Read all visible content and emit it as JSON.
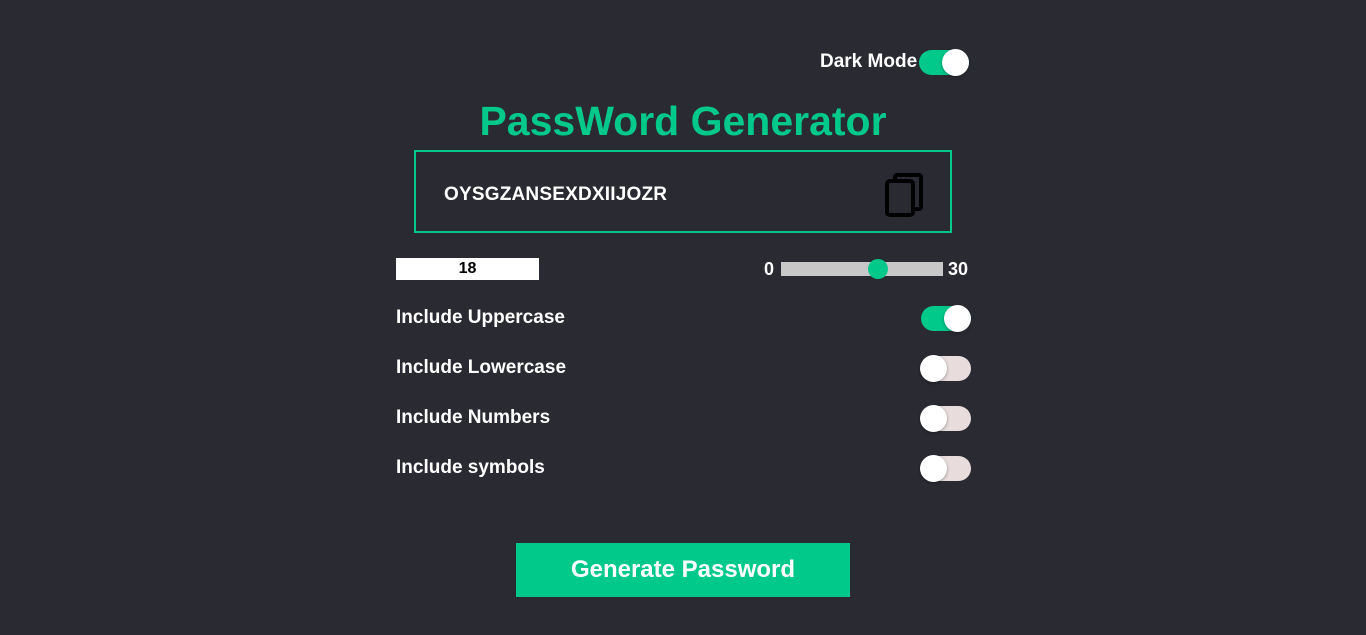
{
  "dark_mode": {
    "label": "Dark Mode",
    "enabled": true
  },
  "title": "PassWord Generator",
  "output": {
    "password": "OYSGZANSEXDXIIJOZR",
    "copy_icon": "copy-icon"
  },
  "length": {
    "value": "18",
    "min_label": "0",
    "max_label": "30",
    "min": 0,
    "max": 30,
    "current": 18
  },
  "options": [
    {
      "label": "Include Uppercase",
      "enabled": true
    },
    {
      "label": "Include Lowercase",
      "enabled": false
    },
    {
      "label": "Include Numbers",
      "enabled": false
    },
    {
      "label": "Include symbols",
      "enabled": false
    }
  ],
  "generate_button": {
    "label": "Generate Password"
  },
  "colors": {
    "background": "#2a2a33",
    "accent": "#00c98a",
    "toggle_off": "#e8dcdc",
    "slider_track": "#c8c8c8"
  }
}
